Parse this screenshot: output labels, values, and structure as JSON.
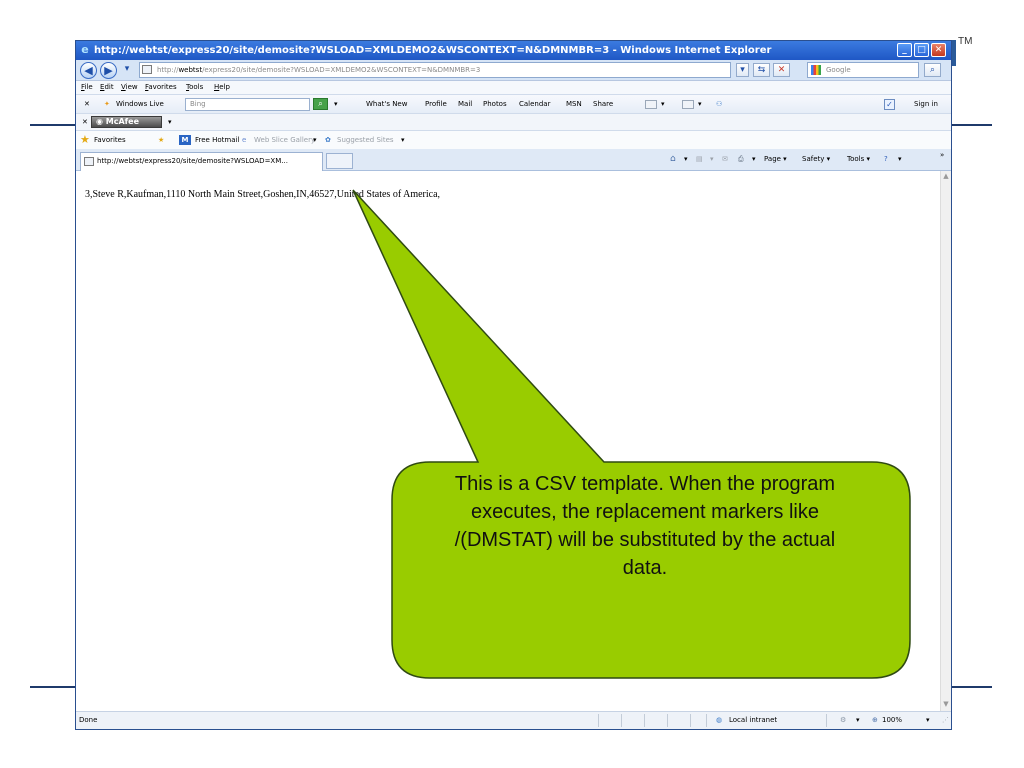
{
  "window": {
    "title": "http://webtst/express20/site/demosite?WSLOAD=XMLDEMO2&WSCONTEXT=N&DMNMBR=3 - Windows Internet Explorer",
    "minimize": "_",
    "maximize": "□",
    "close": "✕"
  },
  "address_bar": {
    "url_prefix": "http://",
    "url_host": "webtst",
    "url_rest": "/express20/site/demosite?WSLOAD=XMLDEMO2&WSCONTEXT=N&DMNMBR=3",
    "search_placeholder": "Google"
  },
  "menu": [
    "File",
    "Edit",
    "View",
    "Favorites",
    "Tools",
    "Help"
  ],
  "toolbar": {
    "windows_live": "Windows Live",
    "bing_placeholder": "Bing",
    "links": [
      "What's New",
      "Profile",
      "Mail",
      "Photos",
      "Calendar",
      "MSN",
      "Share"
    ],
    "sign_in": "Sign in",
    "mcafee": "McAfee"
  },
  "favorites_bar": {
    "favorites": "Favorites",
    "items": [
      "Free Hotmail",
      "Web Slice Gallery",
      "Suggested Sites"
    ]
  },
  "tab": {
    "title": "http://webtst/express20/site/demosite?WSLOAD=XM..."
  },
  "command_bar": [
    "Page",
    "Safety",
    "Tools"
  ],
  "content": {
    "csv_line": "3,Steve R,Kaufman,1110 North Main Street,Goshen,IN,46527,United States of America,"
  },
  "status_bar": {
    "status": "Done",
    "zone": "Local intranet",
    "zoom": "100%"
  },
  "callout": {
    "text": "This is a CSV template. When the program executes, the replacement markers like /(DMSTAT) will be substituted by the actual data.",
    "fill": "#99cc00",
    "stroke": "#2f4a12"
  },
  "slide": {
    "trademark": "TM"
  }
}
